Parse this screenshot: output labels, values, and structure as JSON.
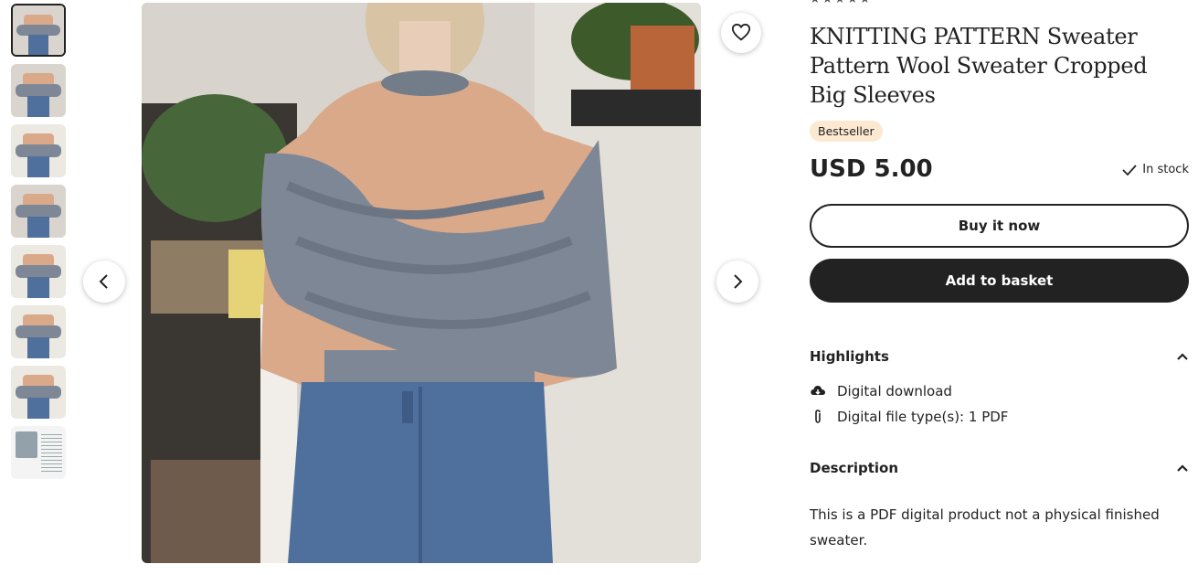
{
  "thumbnails": [
    {
      "label": "Thumbnail 1",
      "active": true
    },
    {
      "label": "Thumbnail 2"
    },
    {
      "label": "Thumbnail 3"
    },
    {
      "label": "Thumbnail 4"
    },
    {
      "label": "Thumbnail 5"
    },
    {
      "label": "Thumbnail 6"
    },
    {
      "label": "Thumbnail 7"
    },
    {
      "label": "Thumbnail 8"
    }
  ],
  "listing": {
    "stars": "★★★★★",
    "title": "KNITTING PATTERN Sweater Pattern Wool Sweater Cropped Big Sleeves",
    "badge": "Bestseller",
    "price": "USD 5.00",
    "stock": "In stock",
    "buy_now": "Buy it now",
    "add_to_basket": "Add to basket"
  },
  "highlights": {
    "heading": "Highlights",
    "items": [
      "Digital download",
      "Digital file type(s): 1 PDF"
    ]
  },
  "description": {
    "heading": "Description",
    "text": "This is a PDF digital product not a physical finished sweater."
  },
  "icons": {
    "favorite": "heart-icon",
    "prev": "chevron-left-icon",
    "next": "chevron-right-icon",
    "stock": "check-icon",
    "collapse": "chevron-up-icon",
    "download": "cloud-download-icon",
    "file": "paperclip-icon"
  },
  "colors": {
    "badge_bg": "#fde8d2",
    "primary_button": "#222222"
  }
}
